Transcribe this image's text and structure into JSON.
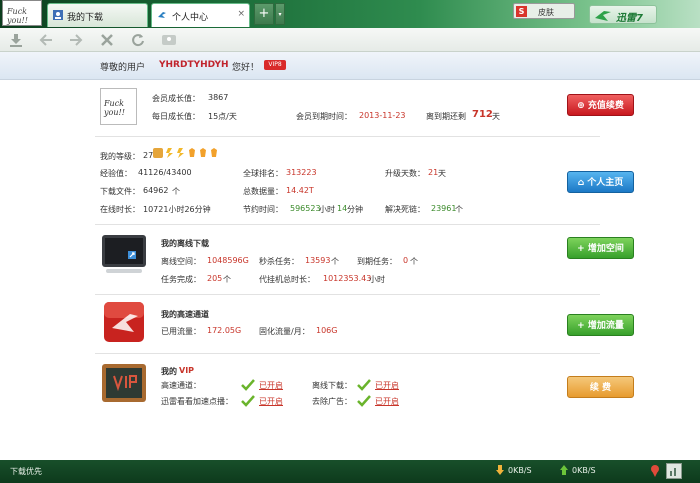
{
  "tabs": [
    {
      "label": "我的下载"
    },
    {
      "label": "个人中心",
      "close": "×"
    }
  ],
  "titlebar": {
    "add_tab": "+",
    "dropdown": "▾",
    "skin_label": "皮肤",
    "skin_icon_letter": "S",
    "brand": "迅雷7",
    "avatar_text": "Fuck you!!"
  },
  "greeting": {
    "prefix": "尊敬的用户",
    "username": "YHRDTYHDYH",
    "suffix": "您好！",
    "vip_badge": "VIP8"
  },
  "growth": {
    "label_growth": "会员成长值：",
    "growth": "3867",
    "label_daily": "每日成长值：",
    "daily": "15点/天",
    "label_expire": "会员到期时间：",
    "expire": "2013-11-23",
    "label_remaining": "离到期还剩",
    "remaining": "712",
    "remaining_unit": "天",
    "button": "充值续费"
  },
  "level": {
    "label_level": "我的等级：",
    "level": "27",
    "label_exp": "经验值：",
    "exp": "41126/43400",
    "label_rank": "全球排名：",
    "rank": "313223",
    "label_upgrade": "升级天数：",
    "upgrade": "21",
    "upgrade_unit": "天",
    "label_files": "下载文件：",
    "files": "64962",
    "files_unit": "个",
    "label_total": "总数据量：",
    "total": "14.42T",
    "label_online": "在线时长：",
    "online": "10721小时26分钟",
    "label_saved": "节约时间：",
    "saved_h": "596523",
    "saved_h_unit": "小时",
    "saved_m": "14",
    "saved_m_unit": "分钟",
    "label_dead": "解决死链：",
    "dead": "23961",
    "dead_unit": "个",
    "button": "个人主页"
  },
  "offline": {
    "title": "我的离线下载",
    "label_space": "离线空间：",
    "space": "1048596G",
    "label_instant": "秒杀任务：",
    "instant": "13593",
    "instant_unit": "个",
    "label_expire": "到期任务：",
    "expire": "0",
    "expire_unit": "个",
    "label_done": "任务完成：",
    "done": "205",
    "done_unit": "个",
    "label_proxy": "代挂机总时长：",
    "proxy": "1012353.43",
    "proxy_unit": "小时",
    "button": "增加空间"
  },
  "highspeed": {
    "title": "我的高速通道",
    "label_used": "已用流量：",
    "used": "172.05G",
    "label_fixed": "固化流量/月：",
    "fixed": "106G",
    "button": "增加流量"
  },
  "vip": {
    "title_prefix": "我的",
    "title_vip": "VIP",
    "label_channel": "高速通道：",
    "channel": "已开启",
    "label_offline": "离线下载：",
    "offline": "已开启",
    "label_accel": "迅雷看看加速点播：",
    "accel": "已开启",
    "label_ads": "去除广告：",
    "ads": "已开启",
    "button": "续 费"
  },
  "statusbar": {
    "priority": "下载优先",
    "down_speed": "0KB/S",
    "up_speed": "0KB/S"
  },
  "colors": {
    "accent_red": "#c8352a",
    "accent_green": "#3a8a2a",
    "title_green": "#1a6a37"
  }
}
